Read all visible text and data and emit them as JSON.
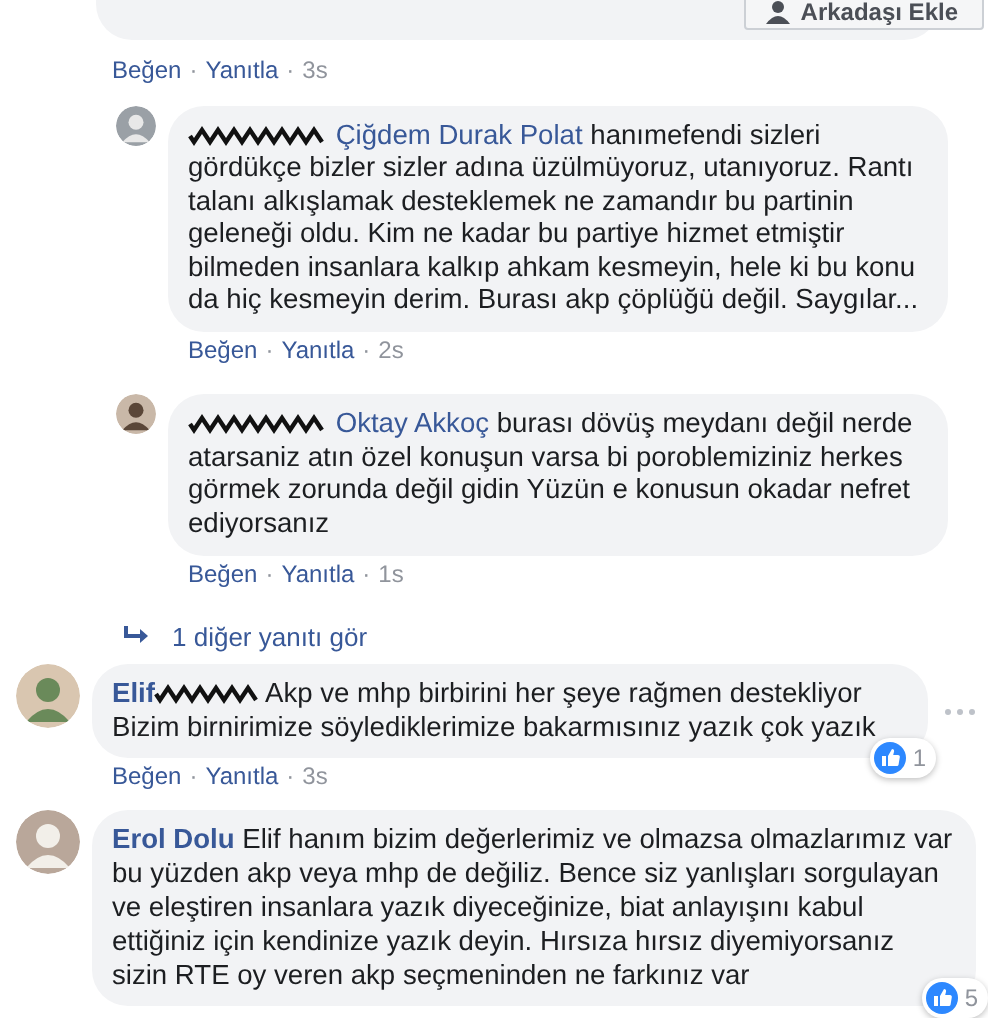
{
  "top_button": {
    "label": "Arkadaşı Ekle"
  },
  "previous_meta": [
    {
      "kind": "link",
      "text": "Beğen"
    },
    {
      "kind": "sep",
      "text": "·"
    },
    {
      "kind": "link",
      "text": "Yanıtla"
    },
    {
      "kind": "sep",
      "text": "·"
    },
    {
      "kind": "time",
      "text": "3s"
    }
  ],
  "replies": [
    {
      "author_redacted": true,
      "mention": "Çiğdem Durak Polat",
      "text": "hanımefendi sizleri gördükçe bizler sizler adına üzülmüyoruz, utanıyoruz. Rantı talanı alkışlamak desteklemek ne zamandır bu partinin geleneği oldu. Kim ne kadar bu partiye hizmet etmiştir bilmeden insanlara kalkıp ahkam kesmeyin, hele ki bu konu da hiç kesmeyin derim. Burası akp çöplüğü değil. Saygılar...",
      "meta": [
        {
          "kind": "link",
          "text": "Beğen"
        },
        {
          "kind": "sep",
          "text": "·"
        },
        {
          "kind": "link",
          "text": "Yanıtla"
        },
        {
          "kind": "sep",
          "text": "·"
        },
        {
          "kind": "time",
          "text": "2s"
        }
      ]
    },
    {
      "author_redacted": true,
      "mention": "Oktay Akkoç",
      "text": "burası dövüş meydanı değil nerde atarsaniz atın özel konuşun varsa bi poroblemiziniz herkes görmek zorunda değil gidin Yüzün e konusun okadar nefret ediyorsanız",
      "meta": [
        {
          "kind": "link",
          "text": "Beğen"
        },
        {
          "kind": "sep",
          "text": "·"
        },
        {
          "kind": "link",
          "text": "Yanıtla"
        },
        {
          "kind": "sep",
          "text": "·"
        },
        {
          "kind": "time",
          "text": "1s"
        }
      ]
    }
  ],
  "more_replies": {
    "label": "1 diğer yanıtı gör"
  },
  "comments": [
    {
      "author": "Elif",
      "author_redacted": true,
      "text": "Akp ve mhp birbirini her şeye rağmen destekliyor Bizim birnirimize söylediklerimize bakarmısınız yazık çok yazık",
      "reactions": "1",
      "menu_shown": true,
      "meta": [
        {
          "kind": "link",
          "text": "Beğen"
        },
        {
          "kind": "sep",
          "text": "·"
        },
        {
          "kind": "link",
          "text": "Yanıtla"
        },
        {
          "kind": "sep",
          "text": "·"
        },
        {
          "kind": "time",
          "text": "3s"
        }
      ]
    },
    {
      "author": "Erol Dolu",
      "author_redacted": false,
      "text": "Elif hanım bizim değerlerimiz ve olmazsa olmazlarımız var bu yüzden akp veya mhp de değiliz. Bence siz yanlışları sorgulayan ve eleştiren insanlara yazık diyeceğinize, biat anlayışını kabul ettiğiniz için kendinize yazık deyin. Hırsıza hırsız diyemiyorsanız sizin RTE oy veren akp seçmeninden ne farkınız var",
      "reactions": "5",
      "menu_shown": false
    }
  ]
}
